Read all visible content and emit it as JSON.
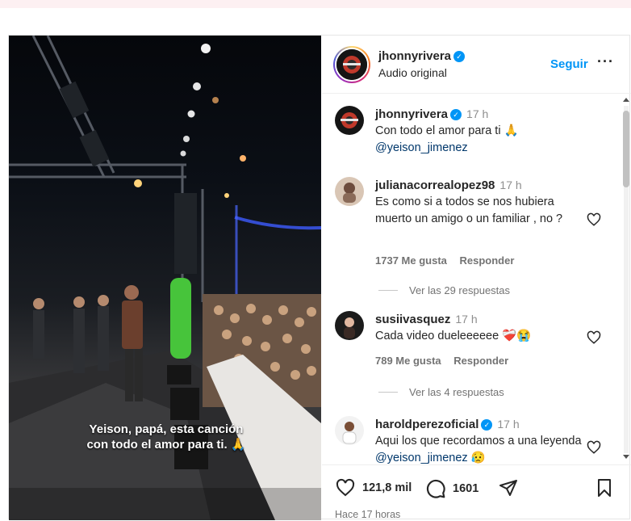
{
  "post": {
    "video": {
      "caption_line1": "Yeison, papá, esta canción",
      "caption_line2": "con todo el amor para ti. 🙏"
    },
    "header": {
      "username": "jhonnyrivera",
      "subtitle": "Audio original",
      "follow_label": "Seguir",
      "more_label": "···"
    },
    "comments": [
      {
        "username": "jhonnyrivera",
        "verified": true,
        "time": "17 h",
        "text": "Con todo el amor para ti 🙏",
        "mention": "@yeison_jimenez"
      },
      {
        "username": "julianacorrealopez98",
        "time": "17 h",
        "text": "Es como si a todos se nos hubiera muerto un amigo o un familiar , no ?",
        "likes": "1737 Me gusta",
        "reply_label": "Responder",
        "view_replies": "Ver las 29 respuestas"
      },
      {
        "username": "susiivasquez",
        "time": "17 h",
        "text": "Cada video dueleeeeee ❤️‍🩹😭",
        "likes": "789 Me gusta",
        "reply_label": "Responder",
        "view_replies": "Ver las 4 respuestas"
      },
      {
        "username": "haroldperezoficial",
        "verified": true,
        "time": "17 h",
        "text": "Aqui los que recordamos a una leyenda",
        "mention": "@yeison_jimenez",
        "emoji": "😥"
      }
    ],
    "actions": {
      "like_count": "121,8 mil",
      "comment_count": "1601",
      "posted_ago": "Hace 17 horas"
    },
    "icons": {
      "like": "heart-icon",
      "comment": "comment-bubble-icon",
      "share": "paper-plane-icon",
      "save": "bookmark-icon",
      "verified": "verified-badge-icon"
    },
    "colors": {
      "accent": "#0095f6",
      "mention": "#00376b",
      "muted": "#737373",
      "text": "#262626"
    }
  }
}
